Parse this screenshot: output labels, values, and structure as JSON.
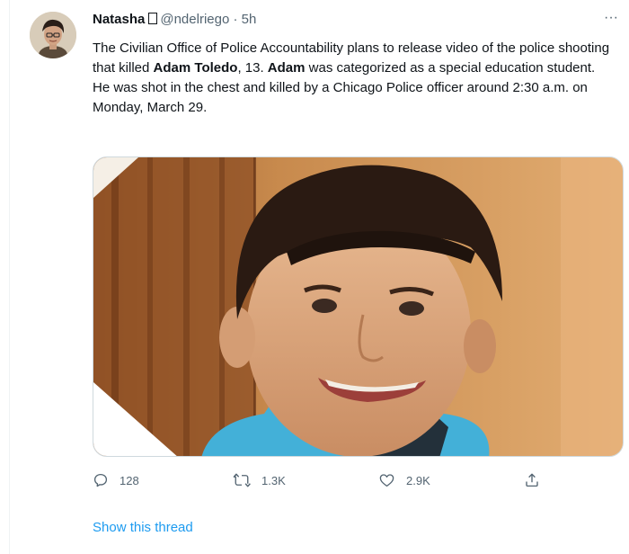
{
  "tweet": {
    "display_name": "Natasha",
    "handle": "@ndelriego",
    "separator": "·",
    "time": "5h",
    "more_glyph": "···",
    "text": {
      "line1_pre": "The Civilian Office of Police Accountability plans to release video of the police shooting that killed ",
      "bold_name_full": "Adam Toledo",
      "line1_mid": ", 13. ",
      "bold_name_first": "Adam",
      "line1_post": " was categorized as a special education student.",
      "line2": "He was shot in the chest and killed by a Chicago Police officer around 2:30 a.m. on Monday, March 29."
    },
    "actions": {
      "replies": "128",
      "retweets": "1.3K",
      "likes": "2.9K"
    },
    "show_thread": "Show this thread"
  },
  "icons": {
    "reply": "reply-icon",
    "retweet": "retweet-icon",
    "like": "heart-icon",
    "share": "share-icon",
    "more": "more-icon"
  },
  "colors": {
    "link": "#1d9bf0",
    "secondary_text": "#536471",
    "primary_text": "#0f1419"
  }
}
